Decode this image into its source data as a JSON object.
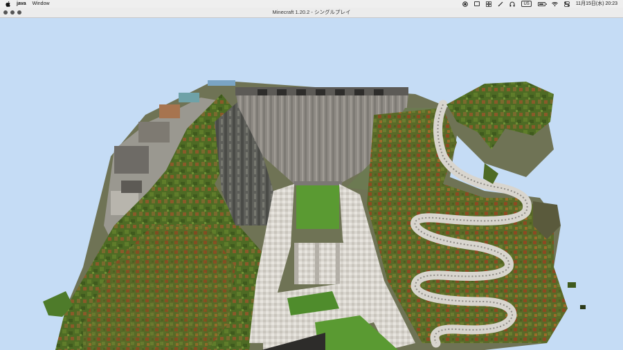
{
  "menubar": {
    "apple_icon": "apple-logo-icon",
    "app_name": "java",
    "menus": [
      "Window"
    ],
    "input_source": "US",
    "clock": "11月15日(水)  20:23"
  },
  "window": {
    "title": "Minecraft 1.20.2 - シングルプレイ"
  },
  "scene": {
    "description_icons": [
      "dam",
      "serpentine-road",
      "forest",
      "town"
    ],
    "sky_color": "#c5dcf5"
  }
}
